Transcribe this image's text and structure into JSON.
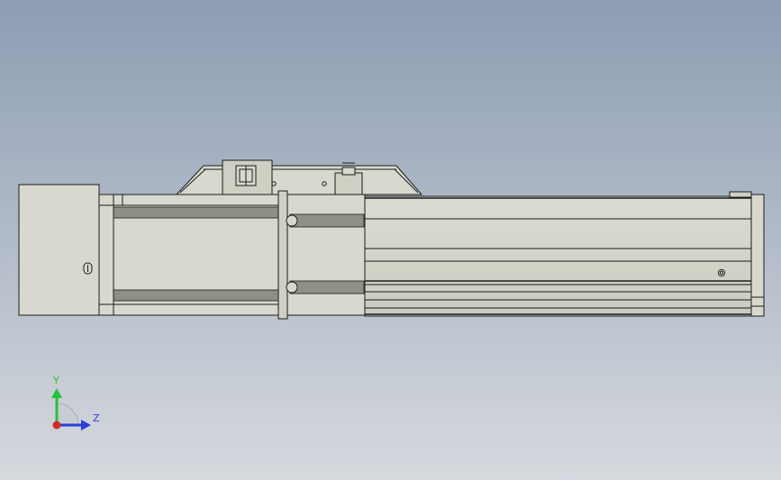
{
  "viewport": {
    "background_top": "#8d9db3",
    "background_bottom": "#d6d9de",
    "part_color": "#d8d8ce",
    "edge_color": "#1c1c1c"
  },
  "triad": {
    "y_label": "Y",
    "z_label": "Z",
    "y_color": "#22c33a",
    "z_color": "#2a3fd6",
    "x_color": "#d42a2a"
  }
}
